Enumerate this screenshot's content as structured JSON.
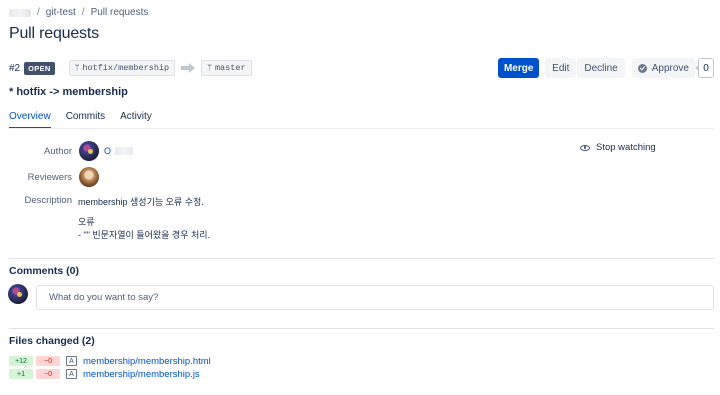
{
  "breadcrumb": {
    "project_hidden": "",
    "repo": "git-test",
    "section": "Pull requests",
    "separator": "/"
  },
  "page_title": "Pull requests",
  "pull_request": {
    "id": "#2",
    "status": "OPEN",
    "source_branch": "hotfix/membership",
    "target_branch": "master",
    "title": "* hotfix -> membership"
  },
  "actions": {
    "merge": "Merge",
    "edit": "Edit",
    "decline": "Decline",
    "approve": "Approve",
    "approve_count": "0"
  },
  "tabs": [
    {
      "label": "Overview",
      "active": true
    },
    {
      "label": "Commits",
      "active": false
    },
    {
      "label": "Activity",
      "active": false
    }
  ],
  "details": {
    "author_label": "Author",
    "author_name": "O",
    "reviewers_label": "Reviewers",
    "description_label": "Description",
    "description_line1": "membership 생성기능 오류 수정.",
    "description_line2": "오류",
    "description_line3": "- \"\" 빈문자열이 들어왔을 경우 처리."
  },
  "watch": {
    "label": "Stop watching"
  },
  "comments": {
    "title": "Comments (0)",
    "placeholder": "What do you want to say?"
  },
  "files": {
    "title": "Files changed (2)",
    "items": [
      {
        "added": "+12",
        "removed": "−0",
        "type": "A",
        "path": "membership/membership.html"
      },
      {
        "added": "+1",
        "removed": "−0",
        "type": "A",
        "path": "membership/membership.js"
      }
    ]
  },
  "colors": {
    "accent": "#0052cc",
    "status_badge": "#42526e",
    "added": "#d6f5d6",
    "removed": "#ffd5d5"
  }
}
